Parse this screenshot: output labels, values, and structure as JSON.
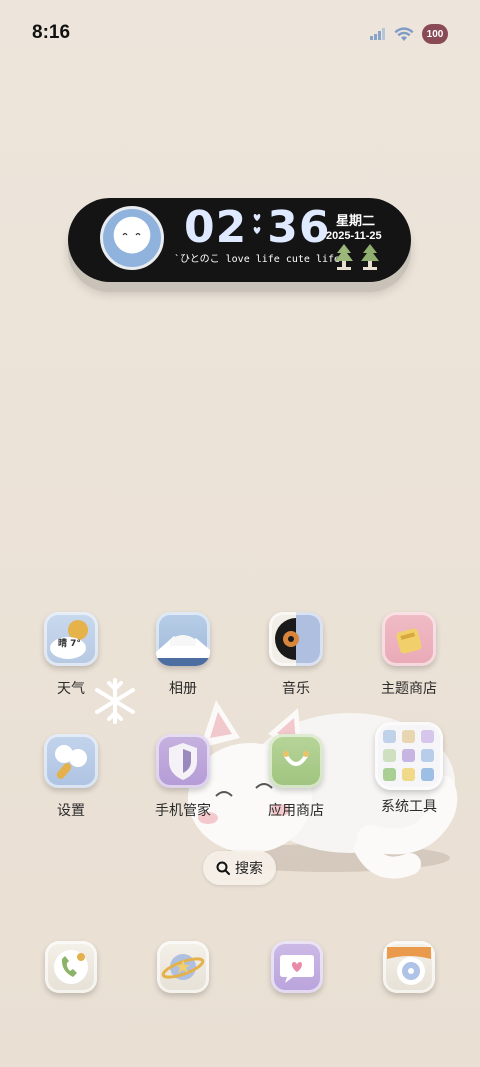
{
  "status_bar": {
    "time": "8:16",
    "icons": [
      "signal-icon",
      "wifi-icon"
    ],
    "battery_level": "100"
  },
  "clock_widget": {
    "hours": "02",
    "minutes": "36",
    "weekday": "星期二",
    "date": "2025-11-25",
    "subtitle": "`ひとのこ love life cute life"
  },
  "apps": {
    "weather": {
      "label": "天气",
      "badge": "晴 7°"
    },
    "gallery": {
      "label": "相册"
    },
    "music": {
      "label": "音乐"
    },
    "theme_store": {
      "label": "主题商店"
    },
    "settings": {
      "label": "设置"
    },
    "phone_manager": {
      "label": "手机管家"
    },
    "app_store": {
      "label": "应用商店"
    },
    "system_tools": {
      "label": "系统工具"
    }
  },
  "search": {
    "label": "搜索",
    "icon": "search-icon"
  },
  "dock": {
    "icons": [
      "phone-icon",
      "browser-icon",
      "messages-icon",
      "camera-icon"
    ]
  },
  "colors": {
    "wallpaper": "#ece3d8",
    "widget_bg": "#141414",
    "digits": "#dfe9ff",
    "battery_badge": "#8a4a55"
  }
}
